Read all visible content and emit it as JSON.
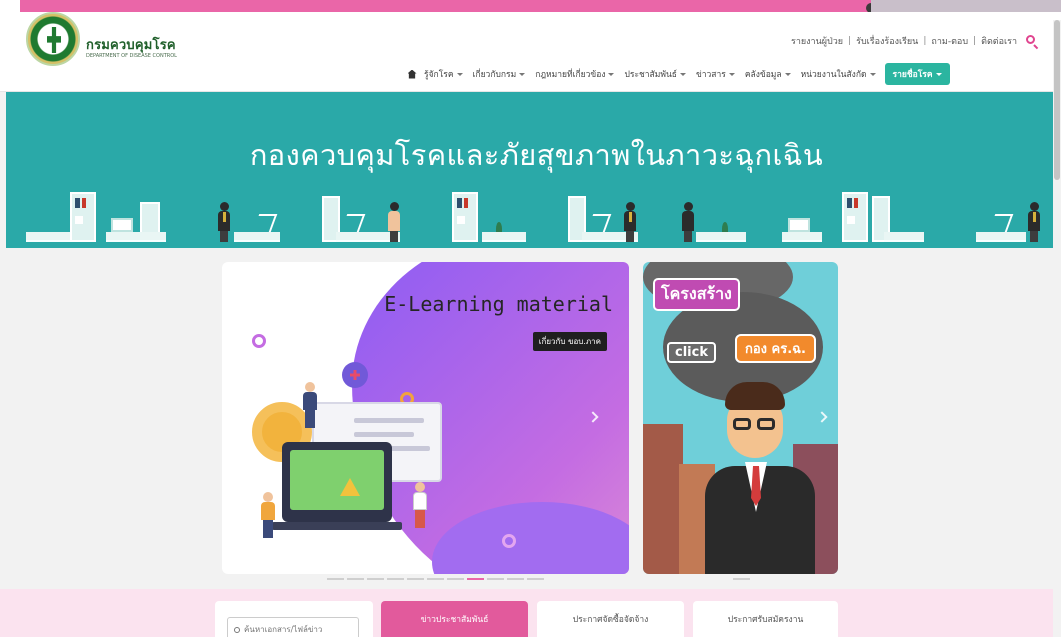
{
  "brand": {
    "title": "กรมควบคุมโรค",
    "subtitle": "DEPARTMENT OF DISEASE CONTROL"
  },
  "utility_links": [
    "รายงานผู้ป่วย",
    "รับเรื่องร้องเรียน",
    "ถาม-ตอบ",
    "ติดต่อเรา"
  ],
  "nav": {
    "items": [
      "รู้จักโรค",
      "เกี่ยวกับกรม",
      "กฎหมายที่เกี่ยวข้อง",
      "ประชาสัมพันธ์",
      "ข่าวสาร",
      "คลังข้อมูล",
      "หน่วยงานในสังกัด"
    ],
    "cta": "รายชื่อโรค"
  },
  "banner": {
    "title": "กองควบคุมโรคและภัยสุขภาพในภาวะฉุกเฉิน"
  },
  "slides": {
    "main_title": "E-Learning material",
    "main_tag": "เกี่ยวกับ ขอบ.ภาค",
    "side_title": "โครงสร้าง",
    "side_click": "click",
    "side_tag": "กอง คร.ฉ."
  },
  "slider": {
    "count": 11,
    "active_index": 7
  },
  "quick_bar": {
    "search_placeholder": "ค้นหาเอกสาร/ไฟล์ข่าว",
    "buttons": [
      {
        "label": "ข่าวประชาสัมพันธ์",
        "active": true
      },
      {
        "label": "ประกาศจัดซื้อจัดจ้าง",
        "active": false
      },
      {
        "label": "ประกาศรับสมัครงาน",
        "active": false
      }
    ]
  },
  "colors": {
    "brand_pink": "#ea66a8",
    "brand_teal": "#2aa9a8",
    "brand_green": "#1f5f2a"
  }
}
